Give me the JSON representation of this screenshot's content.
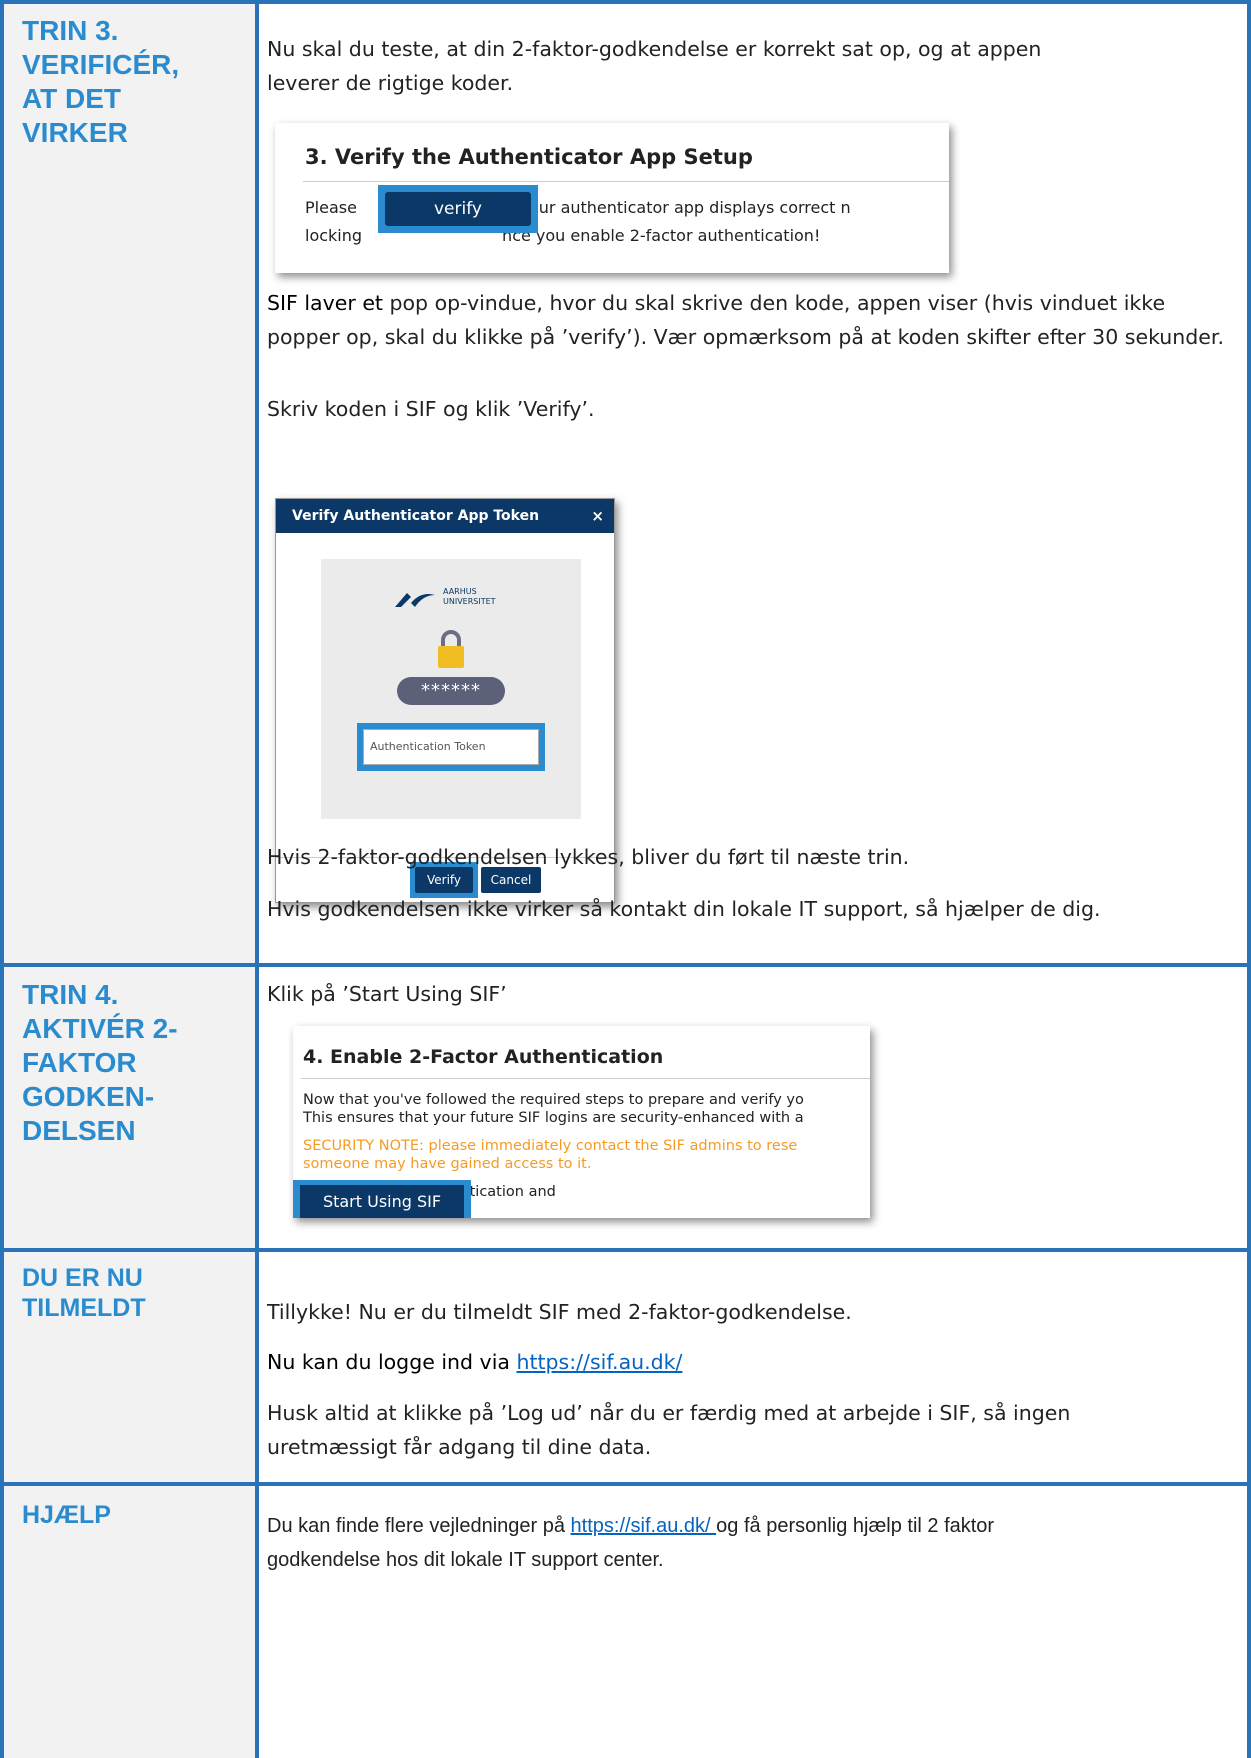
{
  "steps": [
    {
      "heading": "TRIN 3.\nVERIFICÉR,\nAT DET\nVIRKER",
      "intro": "Nu skal du teste, at din 2-faktor-godkendelse er korrekt sat op, og at appen\nleverer de rigtige koder.",
      "popup_text_lead": "SIF laver et",
      "popup_text_rest": " pop op-vindue, hvor du skal skrive den kode, appen viser (hvis vinduet ikke popper op, skal du klikke på ’verify’). Vær opmærksom på at koden skifter efter 30 sekunder.",
      "write_code": "Skriv koden i SIF og klik ’Verify’.",
      "success": "Hvis 2-faktor-godkendelsen lykkes, bliver du ført til næste trin.",
      "failure": "Hvis godkendelsen ikke virker så kontakt din lokale IT support, så hjælper de dig."
    },
    {
      "heading": "TRIN 4.\nAKTIVÉR 2-\nFAKTOR\nGODKEN-\nDELSEN",
      "intro": "Klik på ’Start Using SIF’"
    },
    {
      "heading": "DU ER NU\nTILMELDT",
      "congrats": "Tillykke! Nu er du tilmeldt SIF med 2-faktor-godkendelse.",
      "login_prefix": "Nu kan du logge ind via ",
      "login_link": "https://sif.au.dk/",
      "logout": "Husk altid at klikke på ’Log ud’ når du er færdig med at arbejde i SIF, så ingen\nuretmæssigt får adgang til dine data."
    },
    {
      "heading": "HJÆLP",
      "help_prefix": "Du kan finde flere vejledninger på ",
      "help_link": "https://sif.au.dk/ ",
      "help_rest": "og få personlig hjælp til 2 faktor\ngodkendelse hos dit lokale IT support center."
    }
  ],
  "screenshot_verify_setup": {
    "title": "3. Verify the Authenticator App Setup",
    "line1_prefix": "Please",
    "line1_suffix": "that your authenticator app displays correct n",
    "line2_prefix": "locking",
    "line2_suffix": "nce you enable 2-factor authentication!",
    "button": "verify"
  },
  "screenshot_token_dialog": {
    "title": "Verify Authenticator App Token",
    "close": "×",
    "logo_text": "AARHUS\nUNIVERSITET",
    "password_mask": "******",
    "token_placeholder": "Authentication Token",
    "verify_button": "Verify",
    "cancel_button": "Cancel"
  },
  "screenshot_enable_2fa": {
    "title": "4. Enable 2-Factor Authentication",
    "line1": "Now that you've followed the required steps to prepare and verify yo",
    "line2": "This ensures that your future SIF logins are security-enhanced with a",
    "warn1": "SECURITY NOTE: please immediately contact the SIF admins to rese",
    "warn2": "someone may have gained access to it.",
    "line3": "Enable 2-factor authentication and",
    "button": "Start Using SIF"
  },
  "colors": {
    "heading_blue": "#2a8ccf",
    "border_blue": "#2a73b8",
    "button_navy": "#0b3866",
    "warning_orange": "#f59b23",
    "link_blue": "#0563c1"
  }
}
